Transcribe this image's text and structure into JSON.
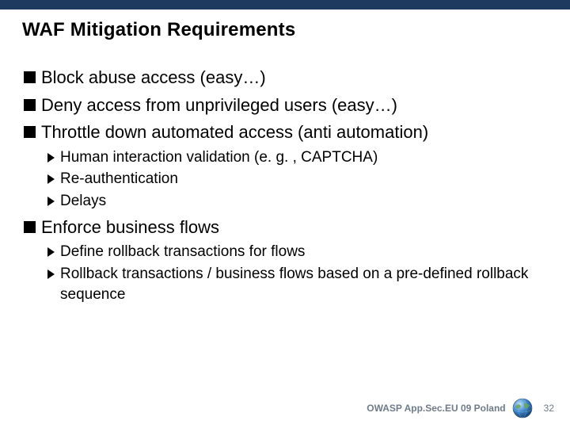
{
  "title": "WAF Mitigation Requirements",
  "bullets": {
    "b1": "Block abuse access (easy…)",
    "b2": "Deny access from unprivileged users (easy…)",
    "b3": "Throttle down automated access (anti automation)",
    "b3_sub1": "Human interaction validation (e. g. , CAPTCHA)",
    "b3_sub2": "Re-authentication",
    "b3_sub3": "Delays",
    "b4": "Enforce business flows",
    "b4_sub1": "Define rollback transactions for flows",
    "b4_sub2": "Rollback transactions / business flows based on a pre-defined rollback sequence"
  },
  "footer": {
    "text": "OWASP App.Sec.EU 09  Poland",
    "page": "32"
  }
}
